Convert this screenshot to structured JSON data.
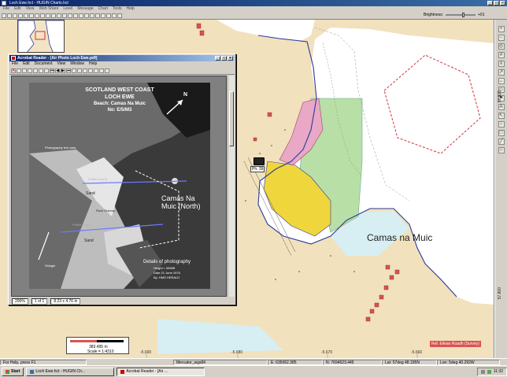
{
  "app": {
    "window_title": "Loch Ewe.hct - HUGIN Charts.hct",
    "menu": [
      "File",
      "Edit",
      "View",
      "Web Share",
      "Level",
      "Message",
      "Chart",
      "Tools",
      "Help"
    ],
    "brightness_label": "Brightness:",
    "brightness_value": "+01",
    "brightness_level": 0.6
  },
  "map": {
    "place_label": "Camas na Muic",
    "camera_label": "Ph. 39",
    "red_tag": "Ref. Eilean Ruadh (Survey)",
    "longitudes": [
      "-5.690",
      "-5.680",
      "-5.670",
      "-5.660"
    ],
    "lat_left": "57.805",
    "lat_right": "57.800",
    "scalebar": {
      "distance": "383.495 m",
      "scale": "Scale = 1:4310"
    }
  },
  "reader": {
    "title": "Acrobat Reader - [Air Photo Loch Ewe.pdf]",
    "menu": [
      "File",
      "Edit",
      "Document",
      "View",
      "Window",
      "Help"
    ],
    "page_width": "200%",
    "page_counter": "1 of 1",
    "page_size": "8.23 x 4.76 in",
    "photo": {
      "heading1": "SCOTLAND WEST COAST",
      "heading2": "LOCH EWE",
      "heading3": "Beach: Camas Na Muic",
      "heading4": "No: E/5/M3",
      "north": "N",
      "annotations": [
        "Photography text area",
        "Sand",
        "Rock Outcrop",
        "Sand",
        "Profile Line B",
        "Profile Line E",
        "Shingle"
      ],
      "area_label": "Camas Na Muic (North)",
      "caption_title": "Details of photography",
      "caption_lines": [
        "Height = 5800ft",
        "Date 21 June 1976",
        "By: HMS HERALD"
      ]
    }
  },
  "status": {
    "help": "For Help, press F1",
    "projection": "Mercator_wgs84",
    "coords_e": "E: 635062.385",
    "coords_n": "N: 7694623.445",
    "lat": "Lat: 57deg 48.195N",
    "lon": "Lon: 5deg 40.292W"
  },
  "taskbar": {
    "start": "Start",
    "tasks": [
      "Loch Ewe.hct - HUGIN Ch...",
      "Acrobat Reader - [Air ..."
    ],
    "active_task": 1,
    "time": "11:32"
  },
  "colors": {
    "land": "#f1e1bd",
    "sea": "#ffffff",
    "shallow": "#d7eef3",
    "green_area": "#b8dfa6",
    "yellow_area": "#efd63c",
    "pink_area": "#e8a8c6",
    "accent_red": "#d9534f"
  }
}
